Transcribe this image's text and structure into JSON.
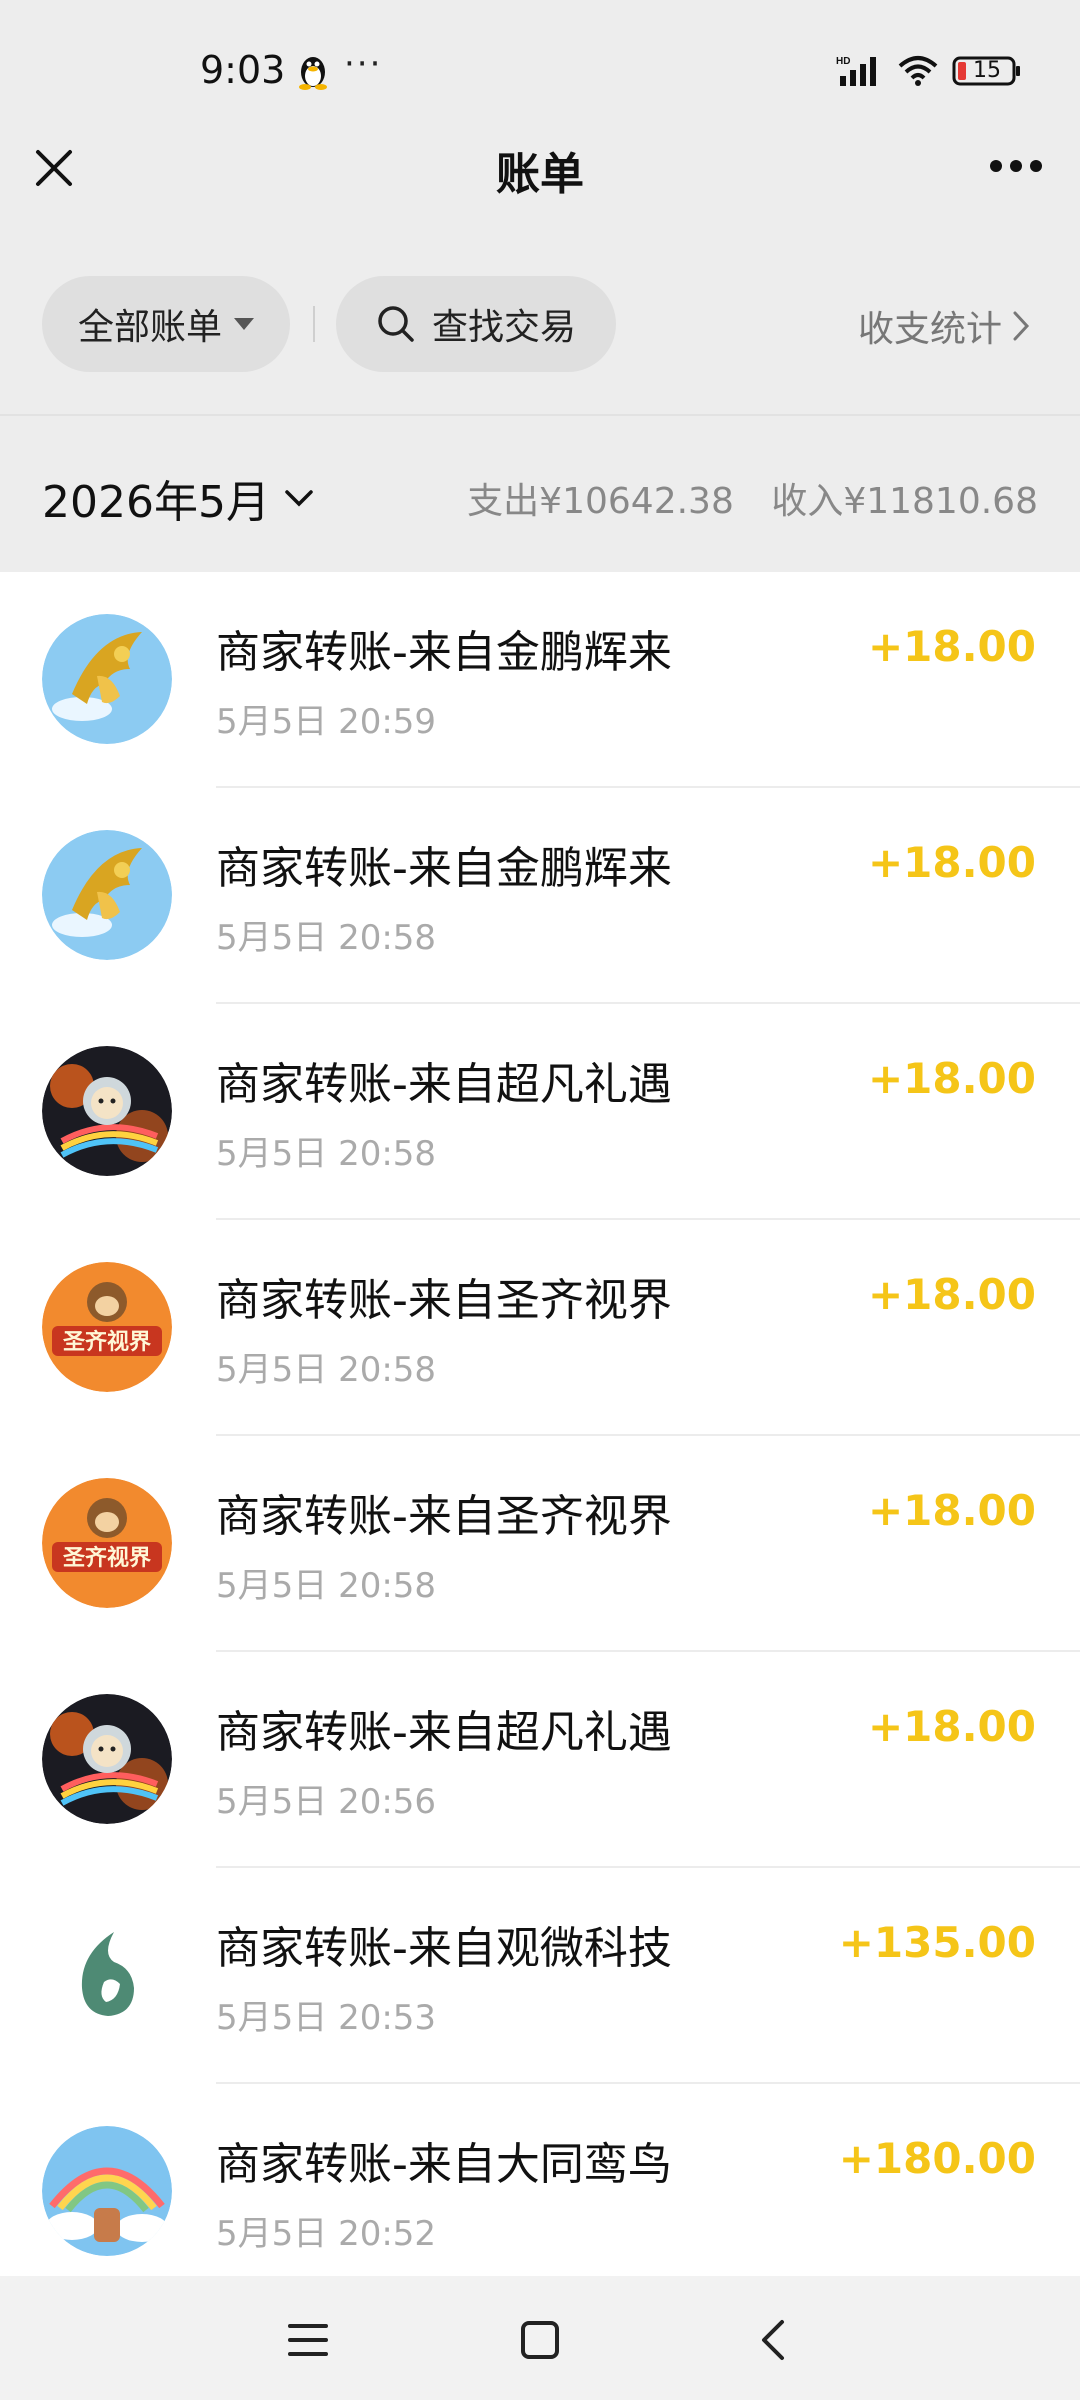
{
  "status": {
    "time": "9:03",
    "dots": "···",
    "battery": "15",
    "icons": [
      "qq-penguin-icon",
      "signal-icon",
      "wifi-icon",
      "battery-icon"
    ]
  },
  "header": {
    "title": "账单",
    "left_icon": "close-icon",
    "right_icon": "more-icon"
  },
  "filters": {
    "all_bills": "全部账单",
    "search": "查找交易",
    "stats": "收支统计"
  },
  "month": {
    "label": "2026年5月",
    "expense": "支出¥10642.38",
    "income": "收入¥11810.68"
  },
  "transactions": [
    {
      "title": "商家转账-来自金鹏辉来",
      "time": "5月5日 20:59",
      "amount": "+18.00",
      "avatar": "eagle"
    },
    {
      "title": "商家转账-来自金鹏辉来",
      "time": "5月5日 20:58",
      "amount": "+18.00",
      "avatar": "eagle"
    },
    {
      "title": "商家转账-来自超凡礼遇",
      "time": "5月5日 20:58",
      "amount": "+18.00",
      "avatar": "astronaut-cat"
    },
    {
      "title": "商家转账-来自圣齐视界",
      "time": "5月5日 20:58",
      "amount": "+18.00",
      "avatar": "monkey-logo",
      "avatar_text": "圣齐视界"
    },
    {
      "title": "商家转账-来自圣齐视界",
      "time": "5月5日 20:58",
      "amount": "+18.00",
      "avatar": "monkey-logo",
      "avatar_text": "圣齐视界"
    },
    {
      "title": "商家转账-来自超凡礼遇",
      "time": "5月5日 20:56",
      "amount": "+18.00",
      "avatar": "astronaut-cat"
    },
    {
      "title": "商家转账-来自观微科技",
      "time": "5月5日 20:53",
      "amount": "+135.00",
      "avatar": "leaf-logo"
    },
    {
      "title": "商家转账-来自大同鸾鸟",
      "time": "5月5日 20:52",
      "amount": "+180.00",
      "avatar": "rainbow-scene"
    }
  ],
  "colors": {
    "amount": "#f5c518",
    "background_gray": "#ededed"
  }
}
